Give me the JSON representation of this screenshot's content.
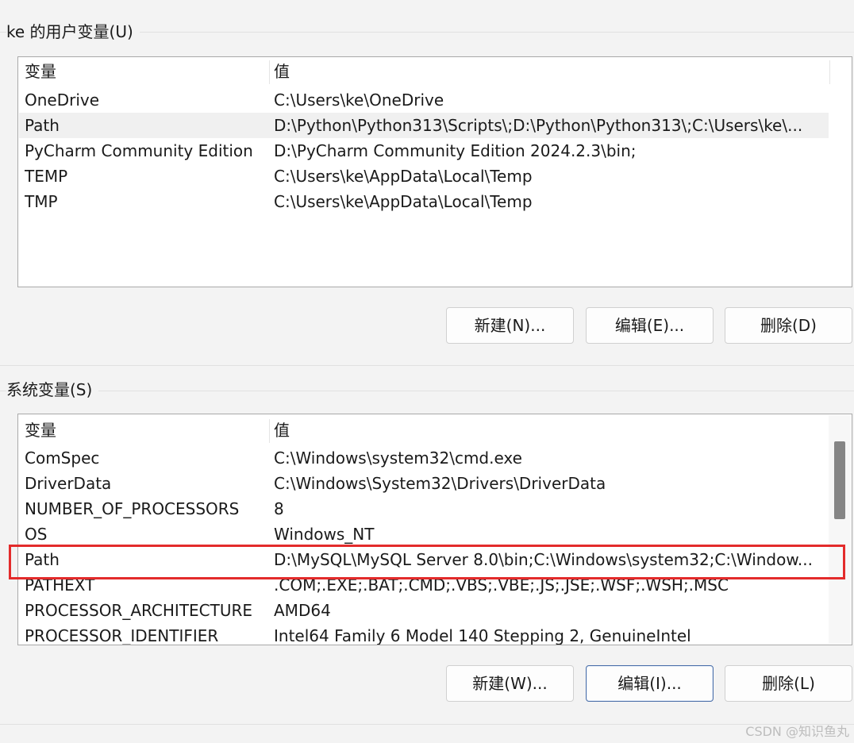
{
  "user_vars": {
    "title": "ke 的用户变量(U)",
    "header": {
      "name": "变量",
      "value": "值"
    },
    "rows": [
      {
        "name": "OneDrive",
        "value": "C:\\Users\\ke\\OneDrive"
      },
      {
        "name": "Path",
        "value": "D:\\Python\\Python313\\Scripts\\;D:\\Python\\Python313\\;C:\\Users\\ke\\..."
      },
      {
        "name": "PyCharm Community Edition",
        "value": "D:\\PyCharm Community Edition 2024.2.3\\bin;"
      },
      {
        "name": "TEMP",
        "value": "C:\\Users\\ke\\AppData\\Local\\Temp"
      },
      {
        "name": "TMP",
        "value": "C:\\Users\\ke\\AppData\\Local\\Temp"
      }
    ],
    "buttons": {
      "new": "新建(N)...",
      "edit": "编辑(E)...",
      "delete": "删除(D)"
    }
  },
  "system_vars": {
    "title": "系统变量(S)",
    "header": {
      "name": "变量",
      "value": "值"
    },
    "rows": [
      {
        "name": "ComSpec",
        "value": "C:\\Windows\\system32\\cmd.exe"
      },
      {
        "name": "DriverData",
        "value": "C:\\Windows\\System32\\Drivers\\DriverData"
      },
      {
        "name": "NUMBER_OF_PROCESSORS",
        "value": "8"
      },
      {
        "name": "OS",
        "value": "Windows_NT"
      },
      {
        "name": "Path",
        "value": "D:\\MySQL\\MySQL Server 8.0\\bin;C:\\Windows\\system32;C:\\Window..."
      },
      {
        "name": "PATHEXT",
        "value": ".COM;.EXE;.BAT;.CMD;.VBS;.VBE;.JS;.JSE;.WSF;.WSH;.MSC"
      },
      {
        "name": "PROCESSOR_ARCHITECTURE",
        "value": "AMD64"
      },
      {
        "name": "PROCESSOR_IDENTIFIER",
        "value": "Intel64 Family 6 Model 140 Stepping 2, GenuineIntel"
      }
    ],
    "buttons": {
      "new": "新建(W)...",
      "edit": "编辑(I)...",
      "delete": "删除(L)"
    }
  },
  "watermark": "CSDN @知识鱼丸"
}
